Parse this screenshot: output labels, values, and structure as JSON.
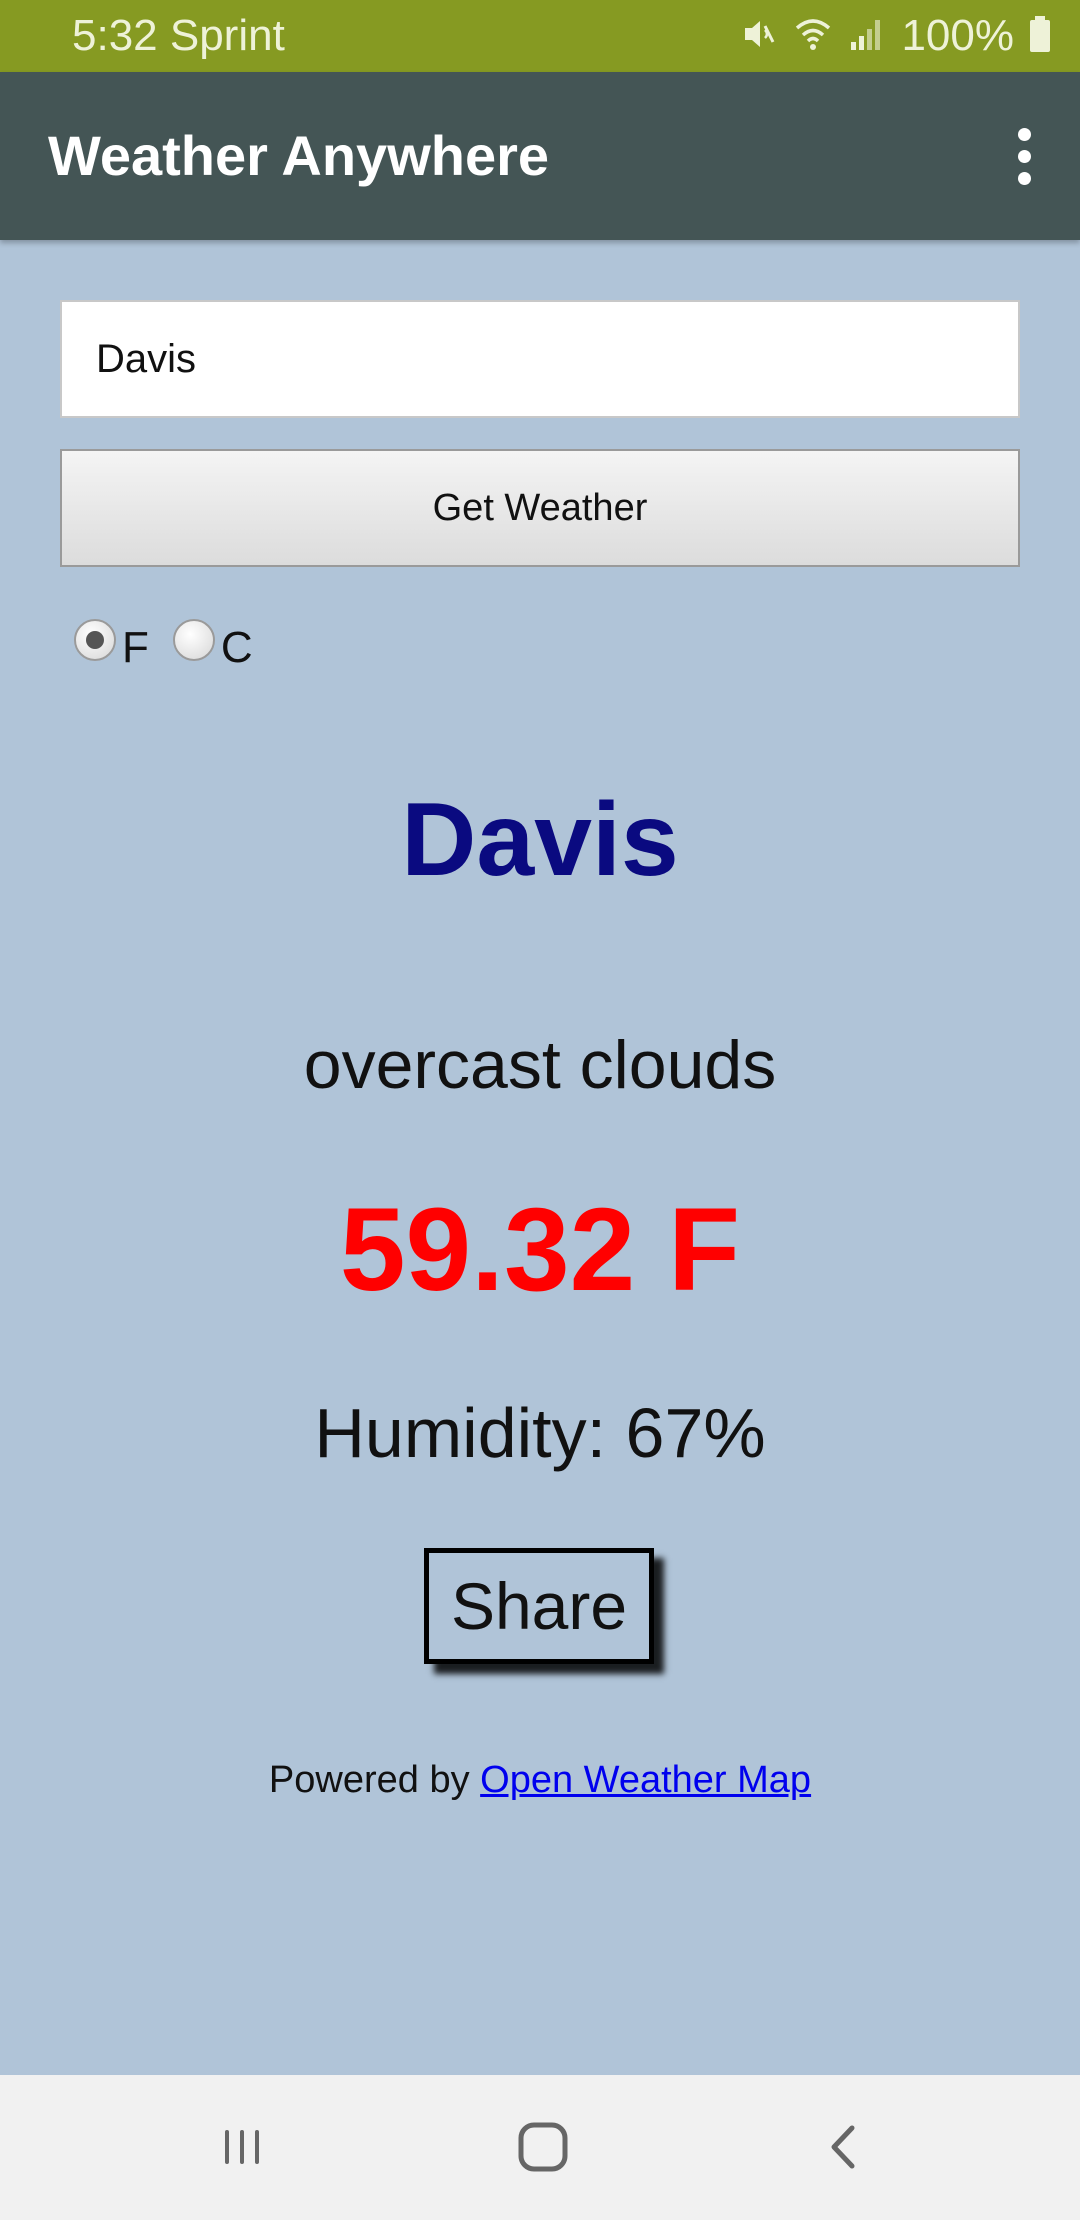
{
  "status_bar": {
    "time": "5:32 Sprint",
    "battery": "100%",
    "icons": [
      "mute-icon",
      "wifi-icon",
      "signal-icon",
      "battery-icon"
    ]
  },
  "app_bar": {
    "title": "Weather Anywhere",
    "menu_icon": "more-vert-icon"
  },
  "search": {
    "value": "Davis",
    "placeholder": ""
  },
  "get_weather_label": "Get Weather",
  "units": {
    "options": [
      "F",
      "C"
    ],
    "selected": "F"
  },
  "result": {
    "city": "Davis",
    "description": "overcast clouds",
    "temperature": "59.32 F",
    "humidity": "Humidity: 67%"
  },
  "share_label": "Share",
  "footer": {
    "prefix": "Powered by ",
    "link_text": "Open Weather Map"
  },
  "nav": {
    "recents_icon": "recents-icon",
    "home_icon": "home-icon",
    "back_icon": "back-icon"
  },
  "colors": {
    "status_bar": "#869a22",
    "app_bar": "#445555",
    "background": "#b0c4d8",
    "city": "#0a0a80",
    "temperature": "#ff0000",
    "link": "#0000ee"
  }
}
